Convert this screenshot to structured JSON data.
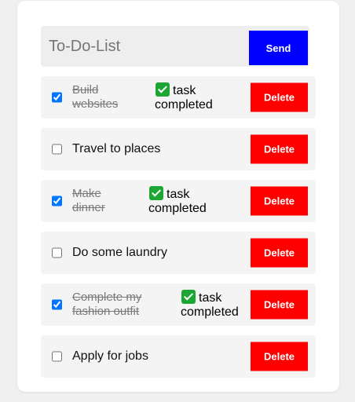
{
  "input": {
    "placeholder": "To-Do-List",
    "value": ""
  },
  "send_label": "Send",
  "delete_label": "Delete",
  "completed_note": {
    "line1": "task",
    "line2": "completed"
  },
  "items": [
    {
      "line1": "Build",
      "line2": "websites",
      "completed": true
    },
    {
      "line1": "Travel to places",
      "line2": "",
      "completed": false
    },
    {
      "line1": "Make",
      "line2": "dinner",
      "completed": true
    },
    {
      "line1": "Do some laundry",
      "line2": "",
      "completed": false
    },
    {
      "line1": "Complete my",
      "line2": "fashion outfit",
      "completed": true
    },
    {
      "line1": "Apply for jobs",
      "line2": "",
      "completed": false
    }
  ],
  "colors": {
    "send": "#0000ff",
    "delete": "#ff0000",
    "check": "#1da634"
  },
  "icons": {
    "completed": "green-check-mark-icon"
  }
}
